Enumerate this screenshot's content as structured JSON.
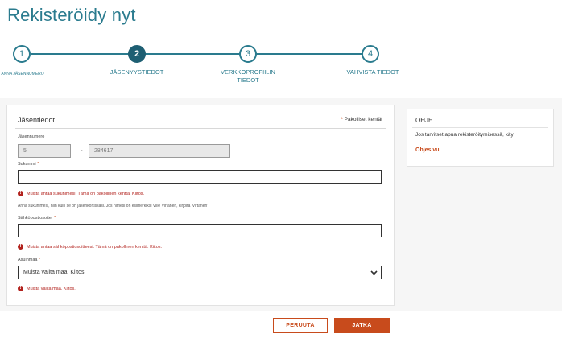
{
  "page": {
    "title": "Rekisteröidy nyt"
  },
  "stepper": {
    "steps": [
      {
        "number": "1",
        "label": "ANNA JÄSENNUMERO"
      },
      {
        "number": "2",
        "label": "JÄSENYYSTIEDOT"
      },
      {
        "number": "3",
        "label": "VERKKOPROFIILIN TIEDOT"
      },
      {
        "number": "4",
        "label": "VAHVISTA TIEDOT"
      }
    ],
    "active_step": 2
  },
  "form": {
    "heading": "Jäsentiedot",
    "required_note": "Pakolliset kentät",
    "member_number": {
      "label": "Jäsennumero",
      "prefix_value": "5",
      "separator": "-",
      "value": "284617"
    },
    "surname": {
      "label": "Sukunimi",
      "value": "",
      "error": "Muista antaa sukunimesi. Tämä on pakollinen kenttä. Kiitos.",
      "hint": "Anna sukunimesi, niin kuin se on jäsenkortissasi. Jos nimesi on esimerkiksi Ville Virtanen, kirjoita 'Virtanen'"
    },
    "email": {
      "label": "Sähköpostiosoite:",
      "value": "",
      "error": "Muista antaa sähköpostiosoitteesi. Tämä on pakollinen kenttä. Kiitos."
    },
    "country": {
      "label": "Asuinmaa",
      "selected": "Muista valita maa. Kiitos.",
      "error": "Muista valita maa. Kiitos."
    }
  },
  "help": {
    "title": "OHJE",
    "text": "Jos tarvitset apua rekisteröitymisessä, käy",
    "link": "Ohjesivu"
  },
  "buttons": {
    "cancel": "PERUUTA",
    "next": "JATKA"
  },
  "colors": {
    "teal": "#2a7b8e",
    "accent": "#c84b1c",
    "error": "#b2221d"
  }
}
